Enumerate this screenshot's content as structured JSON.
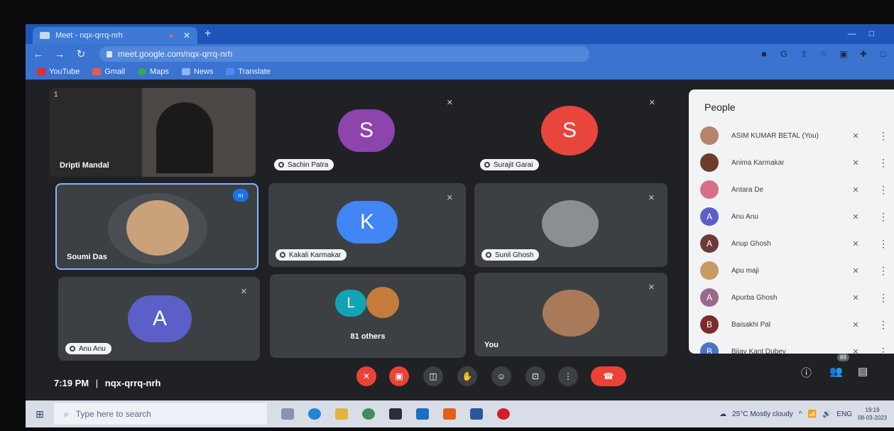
{
  "browser": {
    "tab_title": "Meet - nqx-qrrq-nrh",
    "new_tab": "+",
    "url": "meet.google.com/nqx-qrrq-nrh",
    "bookmarks": [
      "YouTube",
      "Gmail",
      "Maps",
      "News",
      "Translate"
    ]
  },
  "tiles": {
    "t1": {
      "name": "Dripti Mandal",
      "corner": "1"
    },
    "t2": {
      "name": "Sachin Patra",
      "initial": "S"
    },
    "t3": {
      "name": "Surajit Garai",
      "initial": "S"
    },
    "t4": {
      "name": "Soumi Das"
    },
    "t5": {
      "name": "Kakali Karmakar",
      "initial": "K"
    },
    "t6": {
      "name": "Sunil Ghosh"
    },
    "t7": {
      "name": "Anu Anu",
      "initial": "A"
    },
    "t8": {
      "initial": "L",
      "others": "81 others"
    },
    "t9": {
      "name": "You"
    }
  },
  "people": {
    "title": "People",
    "list": [
      {
        "name": "ASIM KUMAR BETAL (You)",
        "initial": "",
        "color": "#b6846a"
      },
      {
        "name": "Anima Karmakar",
        "initial": "",
        "color": "#6b3d2b"
      },
      {
        "name": "Antara De",
        "initial": "",
        "color": "#d86f8a"
      },
      {
        "name": "Anu Anu",
        "initial": "A",
        "color": "#5b5fc7"
      },
      {
        "name": "Anup Ghosh",
        "initial": "A",
        "color": "#6d3a3a"
      },
      {
        "name": "Apu maji",
        "initial": "",
        "color": "#c89a63"
      },
      {
        "name": "Apurba Ghosh",
        "initial": "A",
        "color": "#9a6a8e"
      },
      {
        "name": "Baisakhi Pal",
        "initial": "B",
        "color": "#7a2c2c"
      },
      {
        "name": "Bijay Kant Dubey",
        "initial": "B",
        "color": "#4a72c7"
      }
    ]
  },
  "bottom": {
    "time": "7:19 PM",
    "separator": "|",
    "meeting_code": "nqx-qrrq-nrh",
    "participants_badge": "89"
  },
  "taskbar": {
    "search_placeholder": "Type here to search",
    "weather": "25°C  Mostly cloudy",
    "lang": "ENG",
    "clock_time": "19:19",
    "clock_date": "08-03-2023"
  }
}
